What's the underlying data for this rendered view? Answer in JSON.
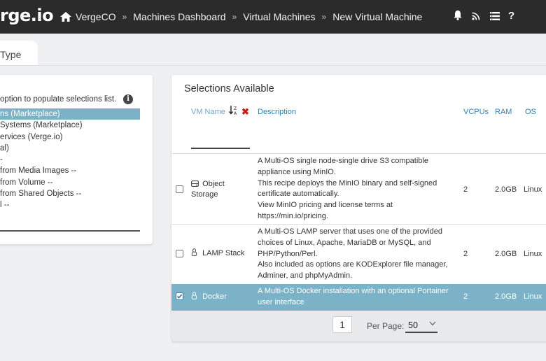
{
  "app": {
    "logo": "rge.io"
  },
  "breadcrumb": [
    "VergeCO",
    "Machines Dashboard",
    "Virtual Machines",
    "New Virtual Machine"
  ],
  "breadcrumb_sep": "»",
  "topbar_icons": [
    "bell-icon",
    "rss-icon",
    "list-icon",
    "help-icon"
  ],
  "help_glyph": "?",
  "tab": {
    "label": "Type"
  },
  "left": {
    "hint": "option to populate selections list.",
    "info_glyph": "i",
    "options": [
      "ns (Marketplace)",
      "Systems (Marketplace)",
      "ervices (Verge.io)",
      "al)",
      "-",
      "from Media Images --",
      "from Volume --",
      "from Shared Objects --",
      "l --"
    ],
    "selected_index": 0
  },
  "selections": {
    "title": "Selections Available",
    "headers": {
      "vm_name": "VM Name",
      "description": "Description",
      "vcpus": "VCPUs",
      "ram": "RAM",
      "os": "OS"
    },
    "clear_glyph": "✖",
    "rows": [
      {
        "checked": false,
        "icon": "storage-icon",
        "name_line1": "Object",
        "name_line2": "Storage",
        "desc": [
          "A Multi-OS single node-single drive S3 compatible",
          "appliance using MinIO.",
          "This recipe deploys the MinIO binary and self-signed",
          "certificate automatically.",
          "View MinIO pricing and license terms at",
          "https://min.io/pricing."
        ],
        "vcpus": "2",
        "ram": "2.0GB",
        "os": "Linux"
      },
      {
        "checked": false,
        "icon": "linux-icon",
        "name_line1": "LAMP Stack",
        "desc": [
          "A Multi-OS LAMP server that uses one of the provided",
          "choices of Linux, Apache, MariaDB or MySQL, and",
          "PHP/Python/Perl.",
          "Also included as options are KODExplorer file manager,",
          "Adminer, and phpMyAdmin."
        ],
        "vcpus": "2",
        "ram": "2.0GB",
        "os": "Linux"
      },
      {
        "checked": true,
        "icon": "linux-icon",
        "name_line1": "Docker",
        "desc": [
          "A Multi-OS Docker installation with an optional Portainer",
          "user interface"
        ],
        "vcpus": "2",
        "ram": "2.0GB",
        "os": "Linux"
      }
    ],
    "pagination": {
      "page": "1",
      "per_page_label": "Per Page:",
      "per_page_value": "50"
    }
  },
  "colors": {
    "topbar": "#2b2b2b",
    "selected_row": "#7cb2c8",
    "header_link": "#2f7fb2",
    "clear_red": "#c41f1f"
  }
}
